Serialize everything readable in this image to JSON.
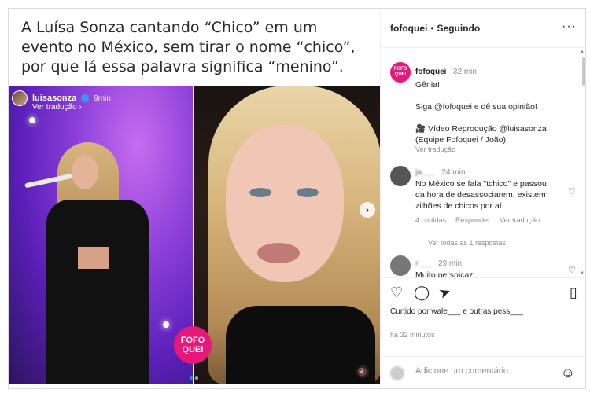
{
  "caption": "A Luísa Sonza cantando “Chico” em um evento no México, sem tirar o nome “chico”, por que lá essa palavra significa “menino”.",
  "story": {
    "username": "luisasonza",
    "time": "9min",
    "translate": "Ver tradução ›"
  },
  "badge": {
    "line1": "FOFO",
    "line2": "QUEI"
  },
  "header": {
    "username": "fofoquei",
    "separator": "•",
    "follow": "Seguindo",
    "more": "···"
  },
  "post": {
    "username": "fofoquei",
    "time": "32 min",
    "lines": [
      "Gênia!",
      "Siga @fofoquei e dê sua opinião!",
      "🎥 Vídeo Reprodução @luisasonza",
      "(Equipe Fofoquei / João)"
    ],
    "translate": "Ver tradução"
  },
  "comments": [
    {
      "username": "ja___",
      "time": "24 min",
      "text": "No México se fala \"tchico\" e passou da hora de desassociarem, existem zilhões de chicos por aí",
      "likes": "4 curtidas",
      "reply": "Responder",
      "translate": "Ver tradução",
      "view_replies": "Ver todas as 1 respostas"
    },
    {
      "username": "r___",
      "time": "29 min",
      "text": "Muito perspicaz"
    }
  ],
  "actions": {
    "like": "♡",
    "comment": "◯",
    "share": "➤",
    "save": "▯"
  },
  "liked_by": "Curtido por wale___ e outras pess___",
  "ago": "há 32 minutos",
  "add_comment": {
    "placeholder": "Adicione um comentário..."
  },
  "icons": {
    "emoji": "☺",
    "next": "›",
    "mute": "🔇"
  },
  "colors": {
    "brand_pink": "#e8187a",
    "link": "#0095f6",
    "text": "#262626",
    "muted": "#8e8e8e"
  }
}
